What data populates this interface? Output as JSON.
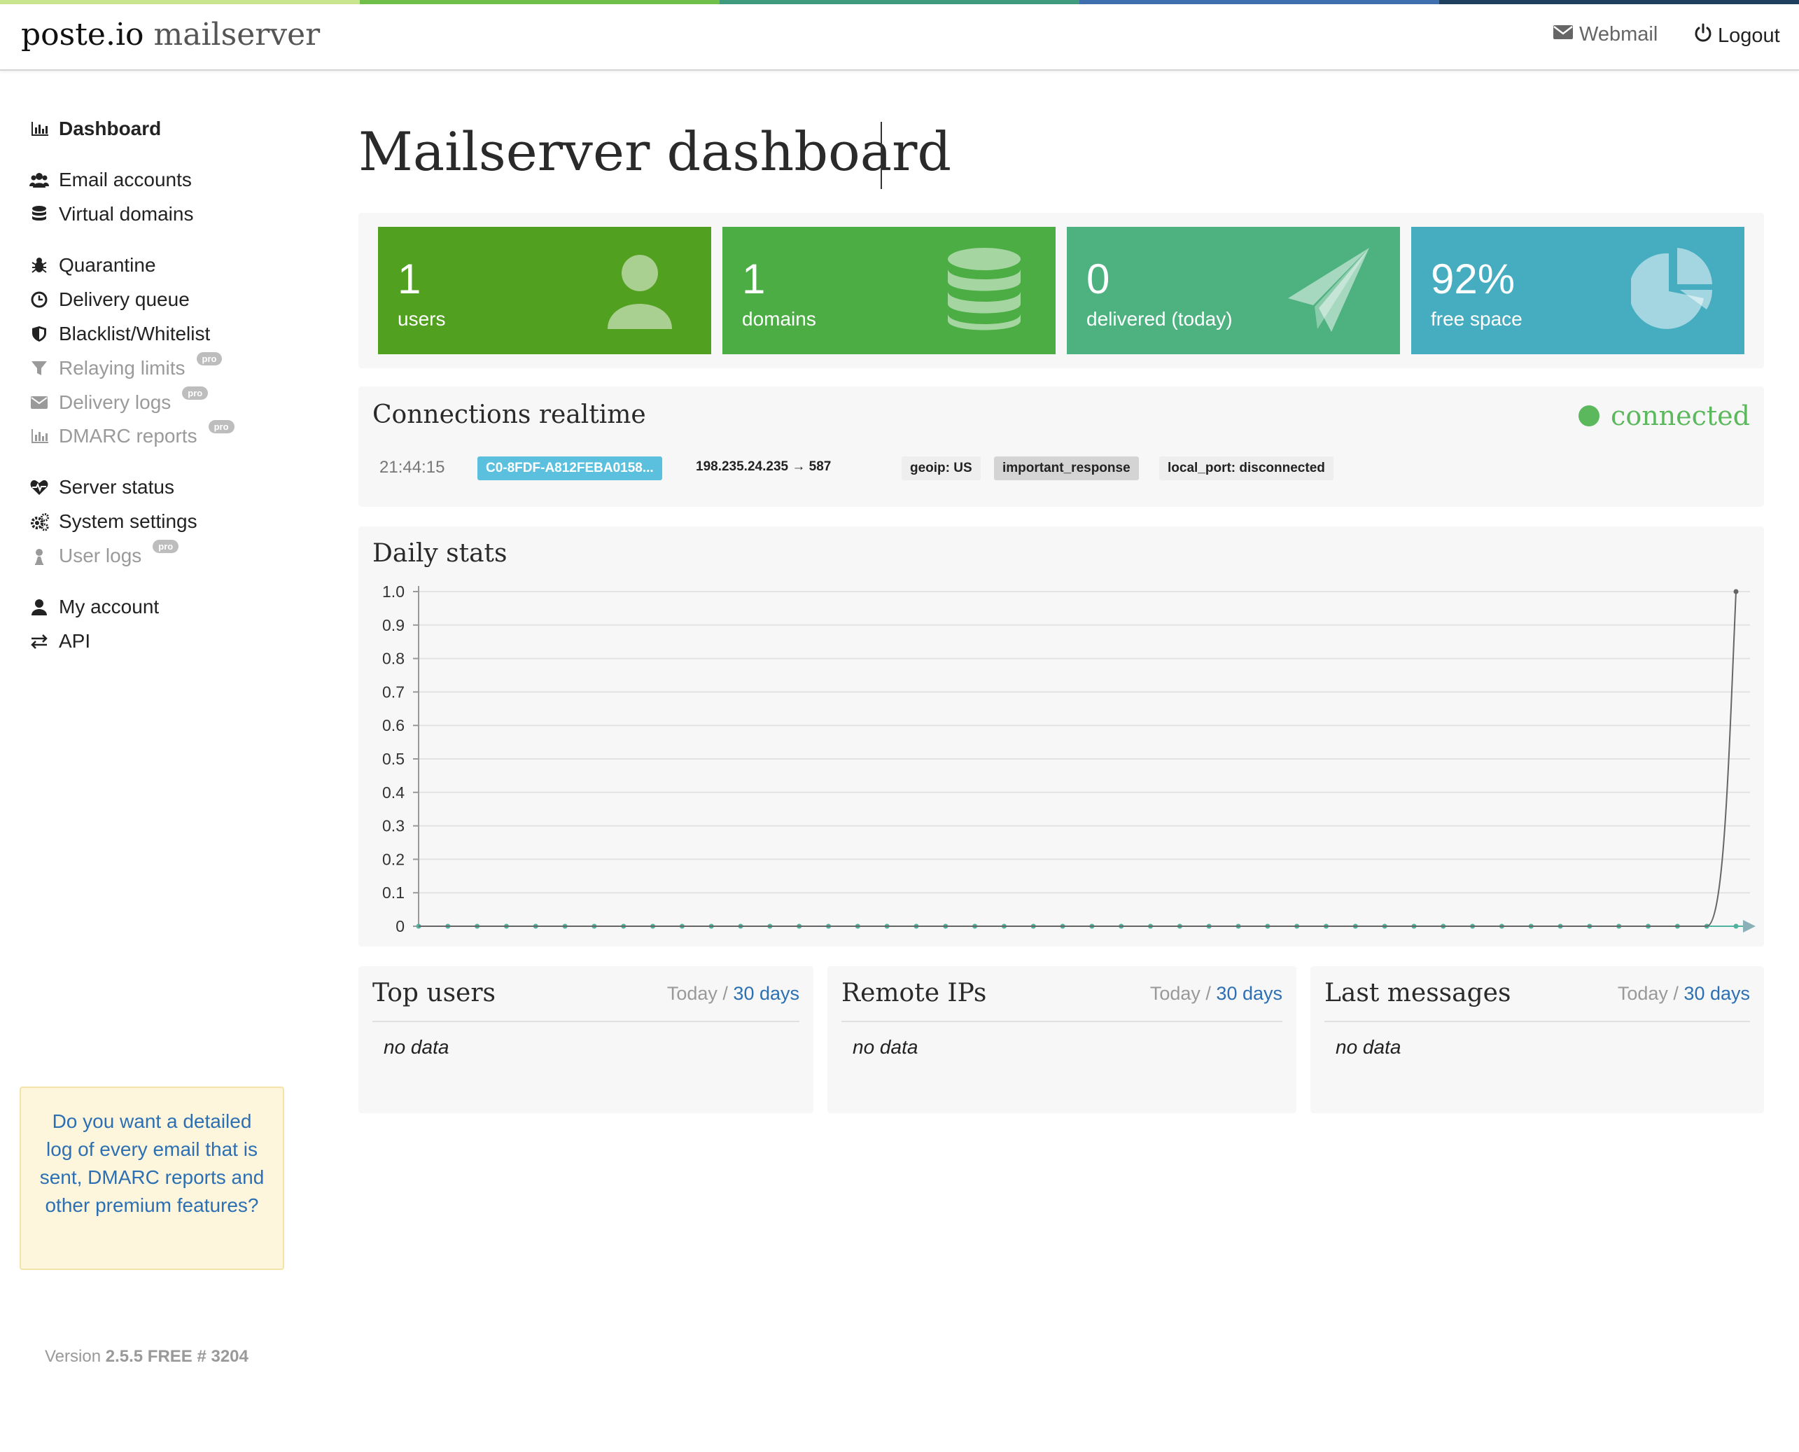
{
  "topbar_colors": [
    "#c9e58f",
    "#6fbf4a",
    "#3f9a7e",
    "#3f6fae",
    "#1f3f5e"
  ],
  "header": {
    "brand_main": "poste.io",
    "brand_sub": "mailserver",
    "webmail_label": "Webmail",
    "logout_label": "Logout"
  },
  "sidebar": {
    "items": [
      {
        "label": "Dashboard",
        "icon": "bar-chart-icon",
        "state": "active"
      },
      {
        "label": "Email accounts",
        "icon": "users-icon",
        "state": "normal"
      },
      {
        "label": "Virtual domains",
        "icon": "database-icon",
        "state": "normal"
      },
      {
        "label": "Quarantine",
        "icon": "bug-icon",
        "state": "normal"
      },
      {
        "label": "Delivery queue",
        "icon": "clock-icon",
        "state": "normal"
      },
      {
        "label": "Blacklist/Whitelist",
        "icon": "shield-icon",
        "state": "normal"
      },
      {
        "label": "Relaying limits",
        "icon": "filter-icon",
        "state": "disabled",
        "badge": "pro"
      },
      {
        "label": "Delivery logs",
        "icon": "envelope-icon",
        "state": "disabled",
        "badge": "pro"
      },
      {
        "label": "DMARC reports",
        "icon": "bar-chart-icon",
        "state": "disabled",
        "badge": "pro"
      },
      {
        "label": "Server status",
        "icon": "heartbeat-icon",
        "state": "normal"
      },
      {
        "label": "System settings",
        "icon": "gears-icon",
        "state": "normal"
      },
      {
        "label": "User logs",
        "icon": "user-secret-icon",
        "state": "disabled",
        "badge": "pro"
      },
      {
        "label": "My account",
        "icon": "user-icon",
        "state": "normal"
      },
      {
        "label": "API",
        "icon": "exchange-icon",
        "state": "normal"
      }
    ],
    "promo": "Do you want a detailed log of every email that is sent, DMARC reports and other premium features?",
    "version_prefix": "Version",
    "version_value": "2.5.5 FREE # 3204"
  },
  "main": {
    "title": "Mailserver dashboard",
    "stats": [
      {
        "value": "1",
        "label": "users",
        "color": "#52a020",
        "icon": "user-icon"
      },
      {
        "value": "1",
        "label": "domains",
        "color": "#4bad44",
        "icon": "database-icon"
      },
      {
        "value": "0",
        "label": "delivered (today)",
        "color": "#4db180",
        "icon": "paper-plane-icon"
      },
      {
        "value": "92%",
        "label": "free space",
        "color": "#46adc0",
        "icon": "pie-chart-icon"
      }
    ],
    "connections": {
      "title": "Connections realtime",
      "status": "connected",
      "status_color": "#5cb85c",
      "row": {
        "time": "21:44:15",
        "id": "C0-8FDF-A812FEBA0158...",
        "route": "198.235.24.235 → 587",
        "tags": [
          "geoip: US",
          "important_response",
          "local_port: disconnected"
        ]
      }
    },
    "daily_stats_title": "Daily stats",
    "panels": [
      {
        "title": "Top users",
        "range_today": "Today",
        "range_sep": "/",
        "range_link": "30 days",
        "empty": "no data"
      },
      {
        "title": "Remote IPs",
        "range_today": "Today",
        "range_sep": "/",
        "range_link": "30 days",
        "empty": "no data"
      },
      {
        "title": "Last messages",
        "range_today": "Today",
        "range_sep": "/",
        "range_link": "30 days",
        "empty": "no data"
      }
    ]
  },
  "chart_data": {
    "type": "line",
    "title": "",
    "xlabel": "",
    "ylabel": "",
    "ylim": [
      0,
      1.0
    ],
    "yticks": [
      "1.0",
      "0.9",
      "0.8",
      "0.7",
      "0.6",
      "0.5",
      "0.4",
      "0.3",
      "0.2",
      "0.1",
      "0"
    ],
    "grid": true,
    "series": [
      {
        "color": "#4fb3a0",
        "values": [
          0,
          0,
          0,
          0,
          0,
          0,
          0,
          0,
          0,
          0,
          0,
          0,
          0,
          0,
          0,
          0,
          0,
          0,
          0,
          0,
          0,
          0,
          0,
          0,
          0,
          0,
          0,
          0,
          0,
          0,
          0,
          0,
          0,
          0,
          0,
          0,
          0,
          0,
          0,
          0,
          0,
          0,
          0,
          0,
          0,
          0
        ]
      },
      {
        "color": "#666666",
        "values": [
          0,
          0,
          0,
          0,
          0,
          0,
          0,
          0,
          0,
          0,
          0,
          0,
          0,
          0,
          0,
          0,
          0,
          0,
          0,
          0,
          0,
          0,
          0,
          0,
          0,
          0,
          0,
          0,
          0,
          0,
          0,
          0,
          0,
          0,
          0,
          0,
          0,
          0,
          0,
          0,
          0,
          0,
          0,
          0,
          0,
          1
        ]
      }
    ]
  }
}
